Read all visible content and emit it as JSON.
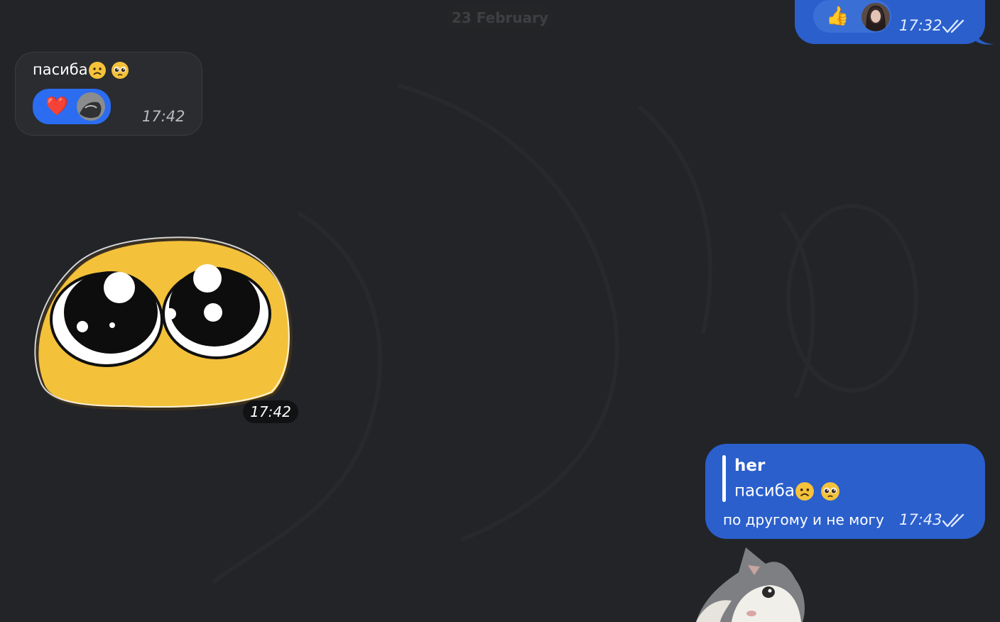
{
  "date_separator": "23 February",
  "messages": [
    {
      "direction": "outgoing",
      "reaction": {
        "emoji": "👍",
        "icon": "thumbs-up-icon"
      },
      "time": "17:32",
      "status": "read"
    },
    {
      "direction": "incoming",
      "text": "пасиба",
      "emojis": [
        "frowning-face-icon",
        "pleading-face-icon"
      ],
      "reaction": {
        "emoji": "❤️",
        "icon": "heart-icon"
      },
      "time": "17:42"
    },
    {
      "direction": "incoming",
      "type": "sticker",
      "sticker": "pleading-eyes-sticker",
      "time": "17:42"
    },
    {
      "direction": "outgoing",
      "reply_to": {
        "author": "her",
        "text": "пасиба",
        "emojis": [
          "frowning-face-icon",
          "pleading-face-icon"
        ]
      },
      "text": "по другому и не могу",
      "time": "17:43",
      "status": "read"
    },
    {
      "direction": "outgoing",
      "type": "sticker",
      "sticker": "cat-sticker"
    }
  ],
  "colors": {
    "background": "#222427",
    "outgoing_bubble": "#2a5fcc",
    "incoming_bubble": "#2a2c2f",
    "reaction_chip": "#2b6cf0"
  }
}
